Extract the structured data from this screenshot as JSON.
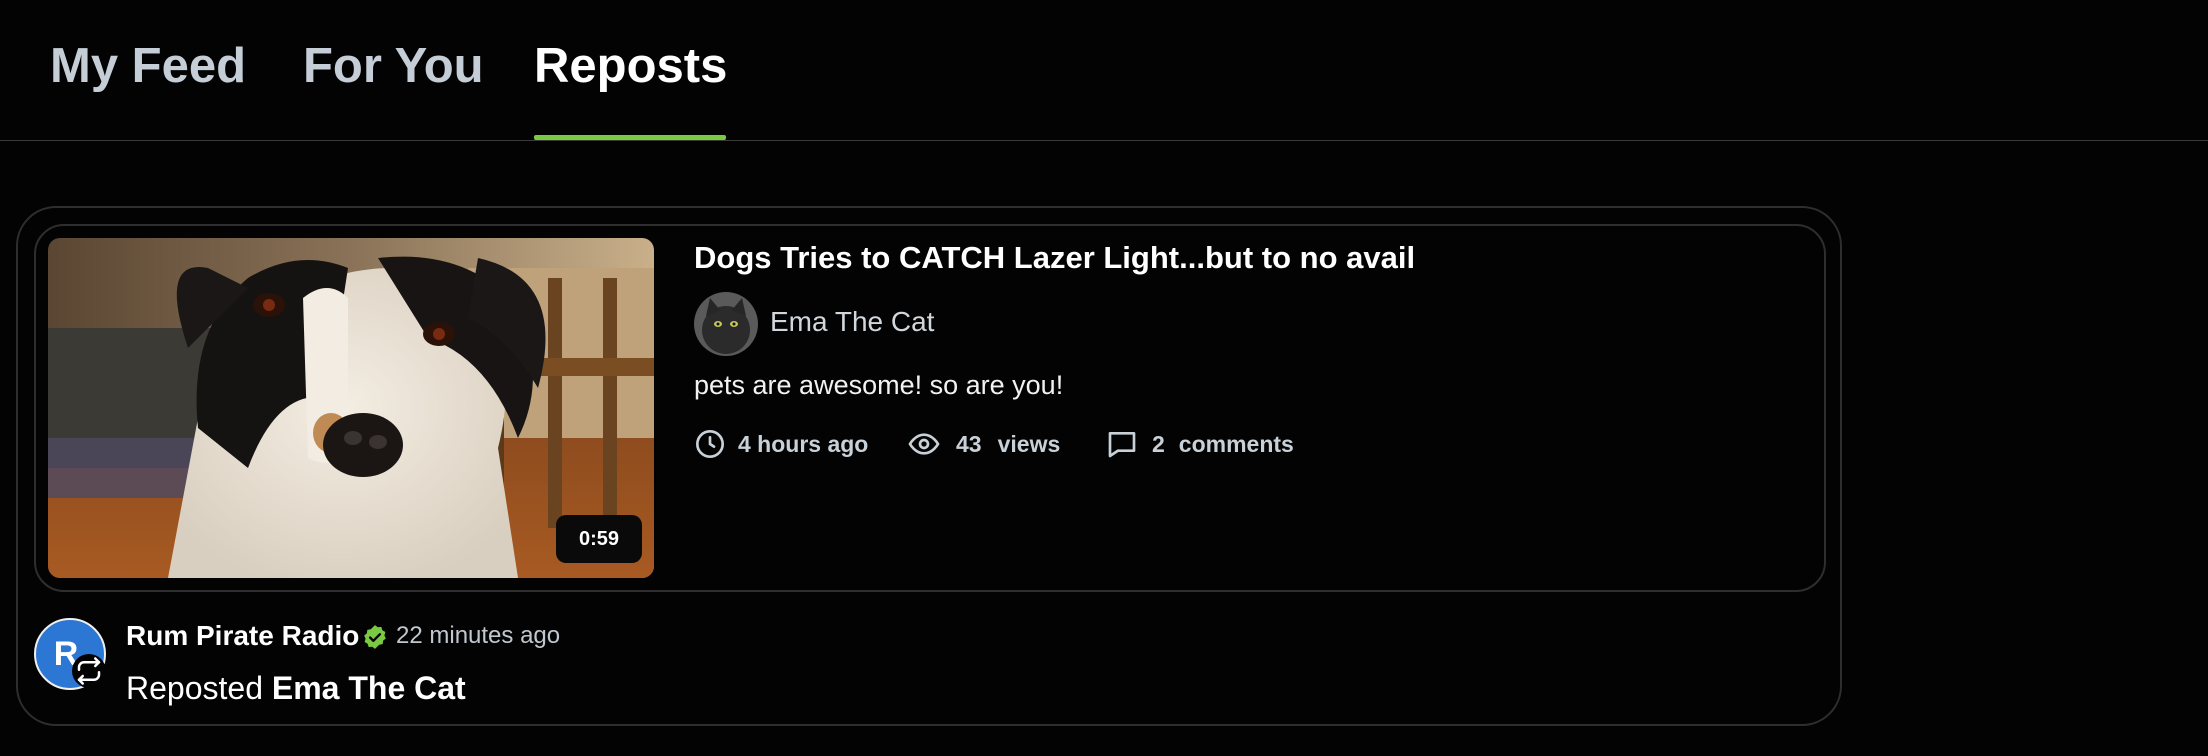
{
  "tabs": [
    {
      "label": "My Feed",
      "active": false
    },
    {
      "label": "For You",
      "active": false
    },
    {
      "label": "Reposts",
      "active": true
    }
  ],
  "accent_color": "#7ac943",
  "repost": {
    "video": {
      "title": "Dogs Tries to CATCH Lazer Light...but to no avail",
      "duration": "0:59",
      "thumbnail": "dog-photo",
      "channel": {
        "name": "Ema The Cat",
        "avatar": "cat-photo"
      },
      "description": "pets are awesome! so are you!",
      "time_ago": "4 hours ago",
      "views_count": "43",
      "views_label": "views",
      "comments_count": "2",
      "comments_label": "comments"
    },
    "reposter": {
      "name": "Rum Pirate Radio",
      "initial": "R",
      "avatar_color": "#2c77d4",
      "verified": true,
      "verified_color": "#7ac943",
      "time_ago": "22 minutes ago",
      "action": "Reposted",
      "target": "Ema The Cat"
    }
  }
}
